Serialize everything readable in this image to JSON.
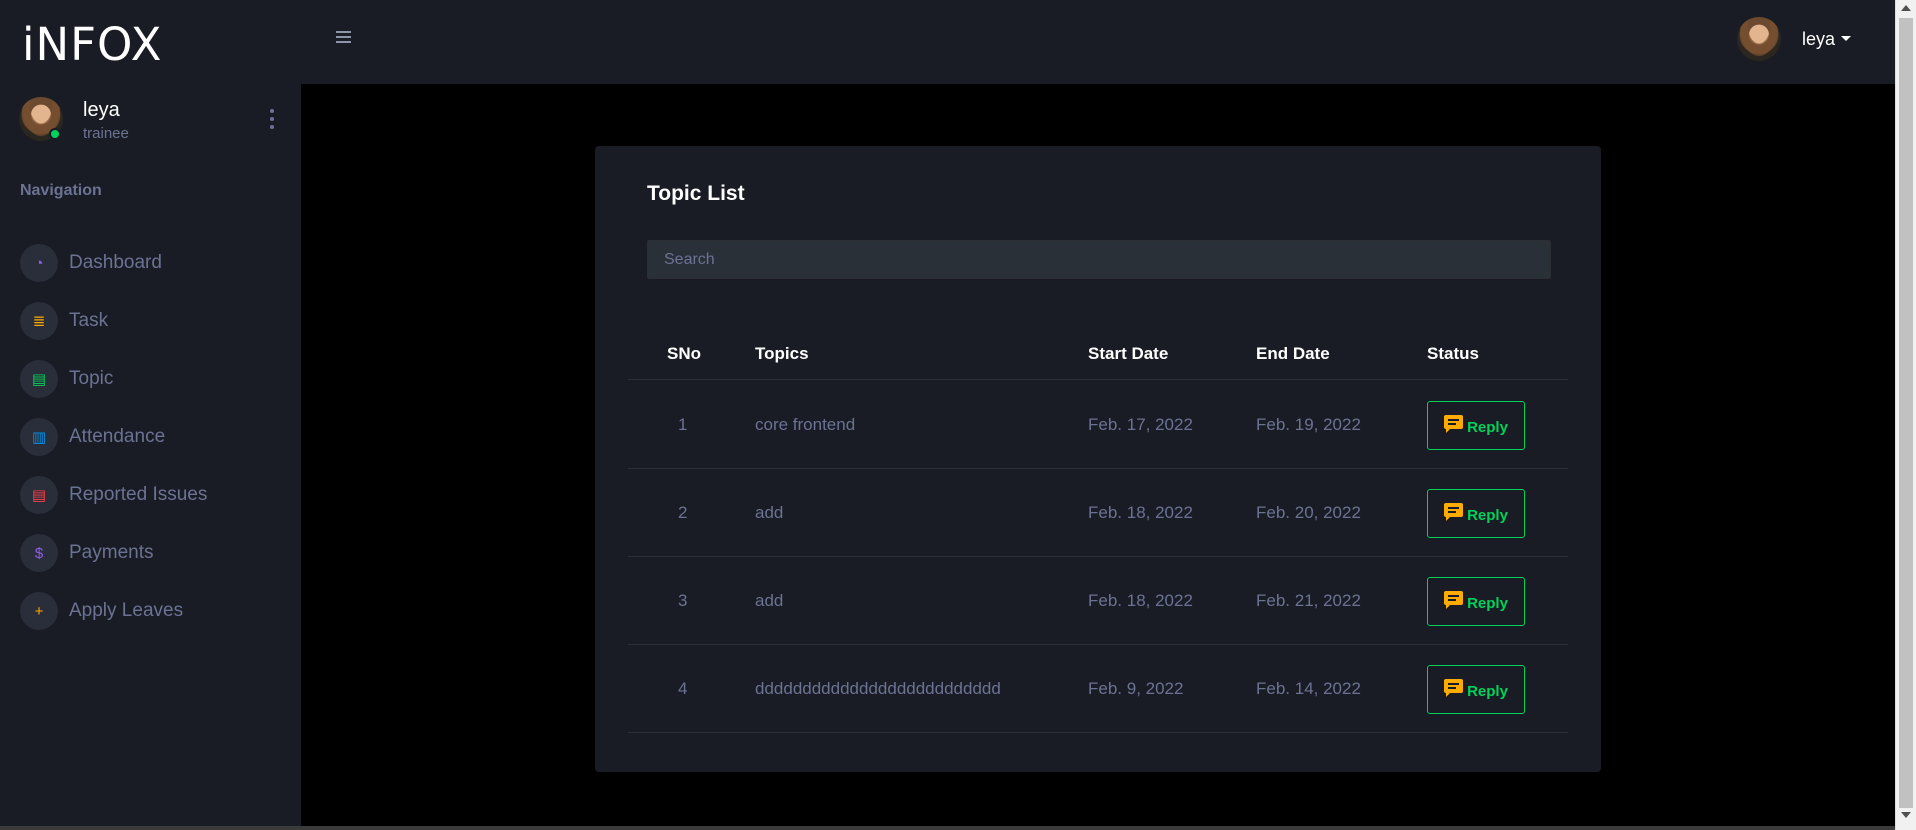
{
  "brand": "iNFOX",
  "profile": {
    "name": "leya",
    "role": "trainee"
  },
  "sidebar": {
    "heading": "Navigation",
    "items": [
      {
        "label": "Dashboard",
        "icon": "speedometer-icon",
        "color": "#8f5fe8",
        "glyph": "◔"
      },
      {
        "label": "Task",
        "icon": "list-lines-icon",
        "color": "#ffab00",
        "glyph": "≣"
      },
      {
        "label": "Topic",
        "icon": "clipboard-icon",
        "color": "#00d25b",
        "glyph": "▤"
      },
      {
        "label": "Attendance",
        "icon": "bar-chart-icon",
        "color": "#0090e7",
        "glyph": "▥"
      },
      {
        "label": "Reported Issues",
        "icon": "document-icon",
        "color": "#fc424a",
        "glyph": "▤"
      },
      {
        "label": "Payments",
        "icon": "money-icon",
        "color": "#8f5fe8",
        "glyph": "$"
      },
      {
        "label": "Apply Leaves",
        "icon": "message-plus-icon",
        "color": "#ffab00",
        "glyph": "+"
      }
    ]
  },
  "topbar": {
    "user": "leya"
  },
  "card": {
    "title": "Topic List",
    "search_placeholder": "Search",
    "columns": [
      "SNo",
      "Topics",
      "Start Date",
      "End Date",
      "Status"
    ],
    "rows": [
      {
        "sno": "1",
        "topic": "core frontend",
        "start": "Feb. 17, 2022",
        "end": "Feb. 19, 2022",
        "status": "Reply"
      },
      {
        "sno": "2",
        "topic": "add",
        "start": "Feb. 18, 2022",
        "end": "Feb. 20, 2022",
        "status": "Reply"
      },
      {
        "sno": "3",
        "topic": "add",
        "start": "Feb. 18, 2022",
        "end": "Feb. 21, 2022",
        "status": "Reply"
      },
      {
        "sno": "4",
        "topic": "dddddddddddddddddddddddddd",
        "start": "Feb. 9, 2022",
        "end": "Feb. 14, 2022",
        "status": "Reply"
      }
    ]
  },
  "colors": {
    "accent_success": "#00d25b",
    "accent_warning": "#ffab00",
    "sidebar_bg": "#191c24",
    "muted_text": "#6c7293"
  }
}
